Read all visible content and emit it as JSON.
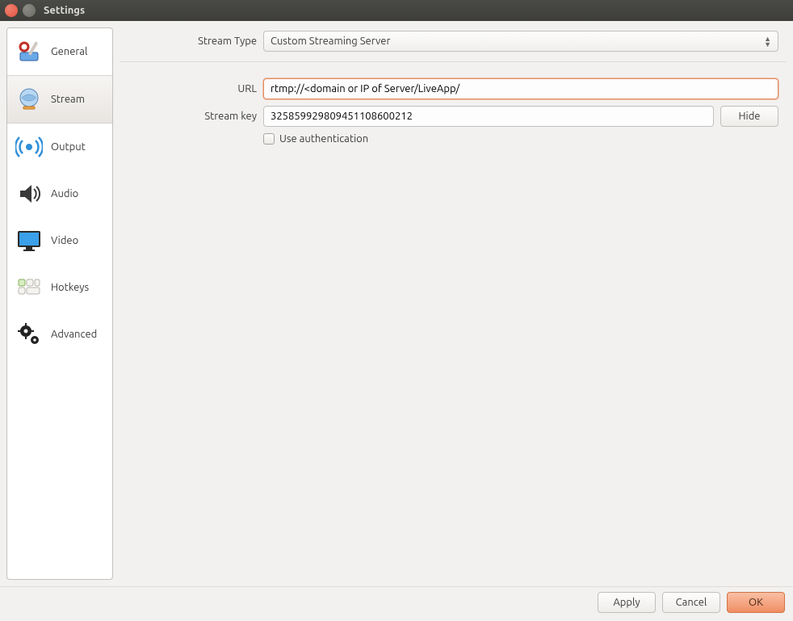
{
  "window": {
    "title": "Settings"
  },
  "sidebar": {
    "items": [
      {
        "label": "General"
      },
      {
        "label": "Stream"
      },
      {
        "label": "Output"
      },
      {
        "label": "Audio"
      },
      {
        "label": "Video"
      },
      {
        "label": "Hotkeys"
      },
      {
        "label": "Advanced"
      }
    ],
    "selected_index": 1
  },
  "form": {
    "stream_type_label": "Stream Type",
    "stream_type_value": "Custom Streaming Server",
    "url_label": "URL",
    "url_value": "rtmp://<domain or IP of Server/LiveApp/",
    "stream_key_label": "Stream key",
    "stream_key_value": "325859929809451108600212",
    "hide_button": "Hide",
    "use_auth_label": "Use authentication",
    "use_auth_checked": false
  },
  "footer": {
    "apply": "Apply",
    "cancel": "Cancel",
    "ok": "OK"
  }
}
